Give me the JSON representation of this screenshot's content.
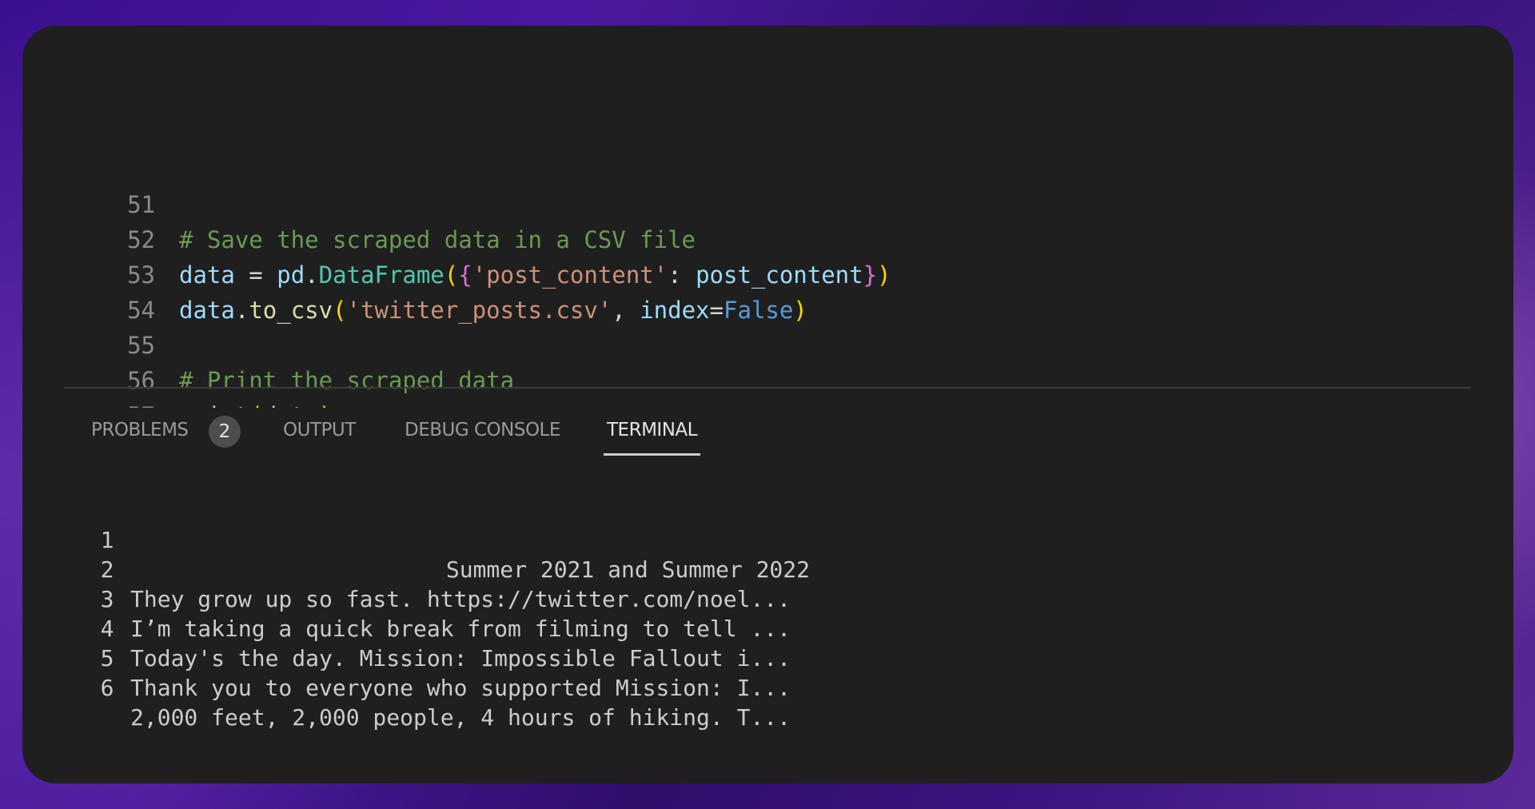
{
  "editor": {
    "lines": [
      {
        "num": "51",
        "tokens": [
          {
            "t": "# Save the scraped data in a CSV file",
            "c": "cmt"
          }
        ]
      },
      {
        "num": "52",
        "tokens": [
          {
            "t": "data",
            "c": "var"
          },
          {
            "t": " = ",
            "c": "op"
          },
          {
            "t": "pd",
            "c": "var"
          },
          {
            "t": ".",
            "c": "op"
          },
          {
            "t": "DataFrame",
            "c": "cls"
          },
          {
            "t": "(",
            "c": "br1"
          },
          {
            "t": "{",
            "c": "br2"
          },
          {
            "t": "'post_content'",
            "c": "str"
          },
          {
            "t": ": ",
            "c": "op"
          },
          {
            "t": "post_content",
            "c": "var"
          },
          {
            "t": "}",
            "c": "br2"
          },
          {
            "t": ")",
            "c": "br1"
          }
        ]
      },
      {
        "num": "53",
        "tokens": [
          {
            "t": "data",
            "c": "var"
          },
          {
            "t": ".",
            "c": "op"
          },
          {
            "t": "to_csv",
            "c": "fn"
          },
          {
            "t": "(",
            "c": "br1"
          },
          {
            "t": "'twitter_posts.csv'",
            "c": "str"
          },
          {
            "t": ", ",
            "c": "op"
          },
          {
            "t": "index",
            "c": "var"
          },
          {
            "t": "=",
            "c": "op"
          },
          {
            "t": "False",
            "c": "kw"
          },
          {
            "t": ")",
            "c": "br1"
          }
        ]
      },
      {
        "num": "54",
        "tokens": []
      },
      {
        "num": "55",
        "tokens": [
          {
            "t": "# Print the scraped data",
            "c": "cmt"
          }
        ]
      },
      {
        "num": "56",
        "tokens": [
          {
            "t": "print",
            "c": "fn"
          },
          {
            "t": "(",
            "c": "br1"
          },
          {
            "t": "data",
            "c": "var"
          },
          {
            "t": ")",
            "c": "br1"
          }
        ]
      },
      {
        "num": "57",
        "tokens": []
      }
    ]
  },
  "panel": {
    "tabs": [
      {
        "label": "PROBLEMS",
        "active": false
      },
      {
        "label": "OUTPUT",
        "active": false
      },
      {
        "label": "DEBUG CONSOLE",
        "active": false
      },
      {
        "label": "TERMINAL",
        "active": true
      }
    ],
    "problems_count": "2"
  },
  "terminal": {
    "rows": [
      {
        "index": "1",
        "text": "Summer 2021 and Summer 2022",
        "align": "right"
      },
      {
        "index": "2",
        "text": "They grow up so fast. https://twitter.com/noel...",
        "align": "left"
      },
      {
        "index": "3",
        "text": "I’m taking a quick break from filming to tell ...",
        "align": "left"
      },
      {
        "index": "4",
        "text": "Today's the day. Mission: Impossible Fallout i...",
        "align": "left"
      },
      {
        "index": "5",
        "text": "Thank you to everyone who supported Mission: I...",
        "align": "left"
      },
      {
        "index": "6",
        "text": "2,000 feet, 2,000 people, 4 hours of hiking. T...",
        "align": "left"
      }
    ]
  }
}
